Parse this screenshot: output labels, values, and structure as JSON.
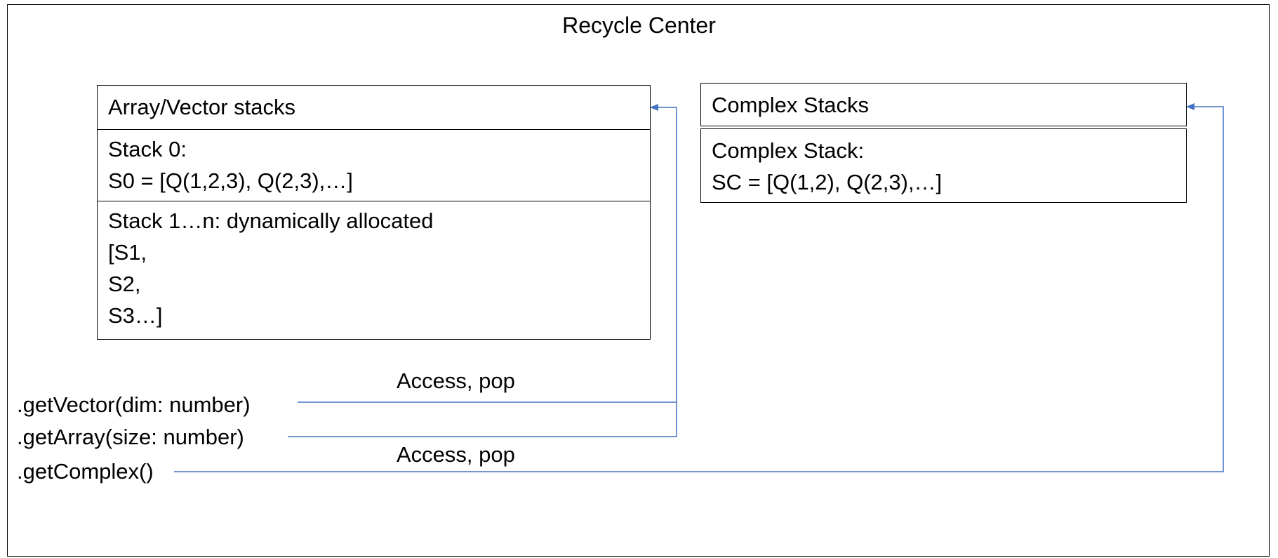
{
  "diagram": {
    "title": "Recycle Center",
    "array_vector_box": {
      "header": "Array/Vector stacks",
      "stack0_lines": [
        "Stack 0:",
        "S0 = [Q(1,2,3), Q(2,3),…]"
      ],
      "stack1n_lines": [
        "Stack 1…n: dynamically allocated",
        "[S1,",
        "S2,",
        "S3…]"
      ]
    },
    "complex_box": {
      "header": "Complex Stacks",
      "stack_lines": [
        "Complex Stack:",
        "SC = [Q(1,2), Q(2,3),…]"
      ]
    },
    "methods": {
      "get_vector": ".getVector(dim: number)",
      "get_array": ".getArray(size: number)",
      "get_complex": ".getComplex()"
    },
    "edge_labels": {
      "vector_array_access": "Access, pop",
      "complex_access": "Access, pop"
    },
    "colors": {
      "connector": "#4472c4",
      "border": "#000000",
      "background": "#ffffff"
    }
  }
}
